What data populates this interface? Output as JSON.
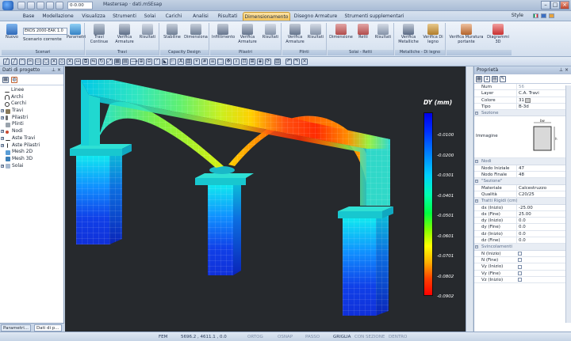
{
  "window": {
    "title": "Mastersap · dati.mSEsap",
    "quick_input": "0-0.00",
    "style_label": "Style",
    "minimize": "–",
    "maximize": "□",
    "close": "×"
  },
  "tabs": [
    "Base",
    "Modellazione",
    "Visualizza",
    "Strumenti",
    "Solai",
    "Carichi",
    "Analisi",
    "Risultati",
    "Dimensionamento",
    "Disegno Armature",
    "Strumenti supplementari"
  ],
  "active_tab": "Dimensionamento",
  "ribbon": {
    "groups": [
      {
        "label": "Scenari"
      },
      {
        "label": "Travi"
      },
      {
        "label": "Capacity Design"
      },
      {
        "label": "Pilastri"
      },
      {
        "label": "Plinti"
      },
      {
        "label": "Solai - Retti"
      },
      {
        "label": "Metalliche - Di legno"
      },
      {
        "label": ""
      }
    ],
    "scenario_combo": "EKOS 2000-EAK 1.0",
    "scenario_sub": "Scenario corrente",
    "buttons": {
      "nuovo": "Nuovo",
      "parametri": "Parametri",
      "travi_continue": "Travi Continue",
      "verifica_armature_1": "Verifica Armature",
      "risultati_1": "Risultati",
      "stabiline": "Stabiline",
      "dimensiona": "Dimensiona",
      "infittimento": "Infittimento",
      "verifica_armature_2": "Verifica Armature",
      "risultati_2": "Risultati",
      "verifica_armature_3": "Verifica Armature",
      "risultati_3": "Risultati",
      "dimensione": "Dimensione",
      "retti": "Retti",
      "risultati_4": "Risultati",
      "verifica_metalliche": "Verifica Metalliche",
      "verifica_legno": "Verifica Di legno",
      "verifica_muratura": "Verifica Muratura portante",
      "diagrammi_3d": "Diagrammi 3D"
    }
  },
  "left_panel": {
    "title": "Dati di progetto",
    "items": [
      "Linee",
      "Archi",
      "Cerchi",
      "Travi",
      "Pilastri",
      "Plinti",
      "Nodi",
      "Aste Travi",
      "Aste Pilastri",
      "Mesh 2D",
      "Mesh 3D",
      "Solai"
    ],
    "bottom_tabs": [
      "Parametri...",
      "Dati di p..."
    ]
  },
  "legend": {
    "title": "DY (mm)",
    "ticks": [
      "-0.0100",
      "-0.0200",
      "-0.0301",
      "-0.0401",
      "-0.0501",
      "-0.0601",
      "-0.0701",
      "-0.0802",
      "-0.0902"
    ]
  },
  "properties": {
    "title": "Proprietà",
    "top": [
      {
        "k": "Num",
        "v": "56",
        "muted": true
      },
      {
        "k": "Layer",
        "v": "C.A. Travi"
      },
      {
        "k": "Colore",
        "v": "31"
      },
      {
        "k": "Tipo",
        "v": "B-3d"
      }
    ],
    "sec_sezione": "Sezione",
    "immagine_label": "Immagine",
    "img_bw": "bw",
    "img_h": "h",
    "sec_nodi": "Nodi",
    "nodi": [
      {
        "k": "Nodo Iniziale",
        "v": "47"
      },
      {
        "k": "Nodo Finale",
        "v": "48"
      }
    ],
    "sec_sezione2": "\"Sezione\"",
    "sezione2": [
      {
        "k": "Materiale",
        "v": "Calcestruzzo"
      },
      {
        "k": "Qualità",
        "v": "C20/25"
      }
    ],
    "sec_tratti": "Tratti Rigidi (cm)",
    "tratti": [
      {
        "k": "dx (Inizio)",
        "v": "-25.00"
      },
      {
        "k": "dx (Fine)",
        "v": "25.00"
      },
      {
        "k": "dy (Inizio)",
        "v": "0.0"
      },
      {
        "k": "dy (Fine)",
        "v": "0.0"
      },
      {
        "k": "dz (Inizio)",
        "v": "0.0"
      },
      {
        "k": "dz (Fine)",
        "v": "0.0"
      }
    ],
    "sec_svincolamenti": "Svincolamenti",
    "svincolamenti": [
      "N (Inizio)",
      "N (Fine)",
      "Vy (Inizio)",
      "Vy (Fine)",
      "Vz (Inizio)"
    ]
  },
  "statusbar": {
    "fem": "FEM",
    "coords": "5696.2 , 4611.1 , 0.0",
    "ortog": "ORTOG",
    "osnap": "OSNAP",
    "passo": "PASSO",
    "griglia": "GRIGLIA",
    "con_sezione": "CON SEZIONE",
    "dentro": "DENTRO"
  }
}
